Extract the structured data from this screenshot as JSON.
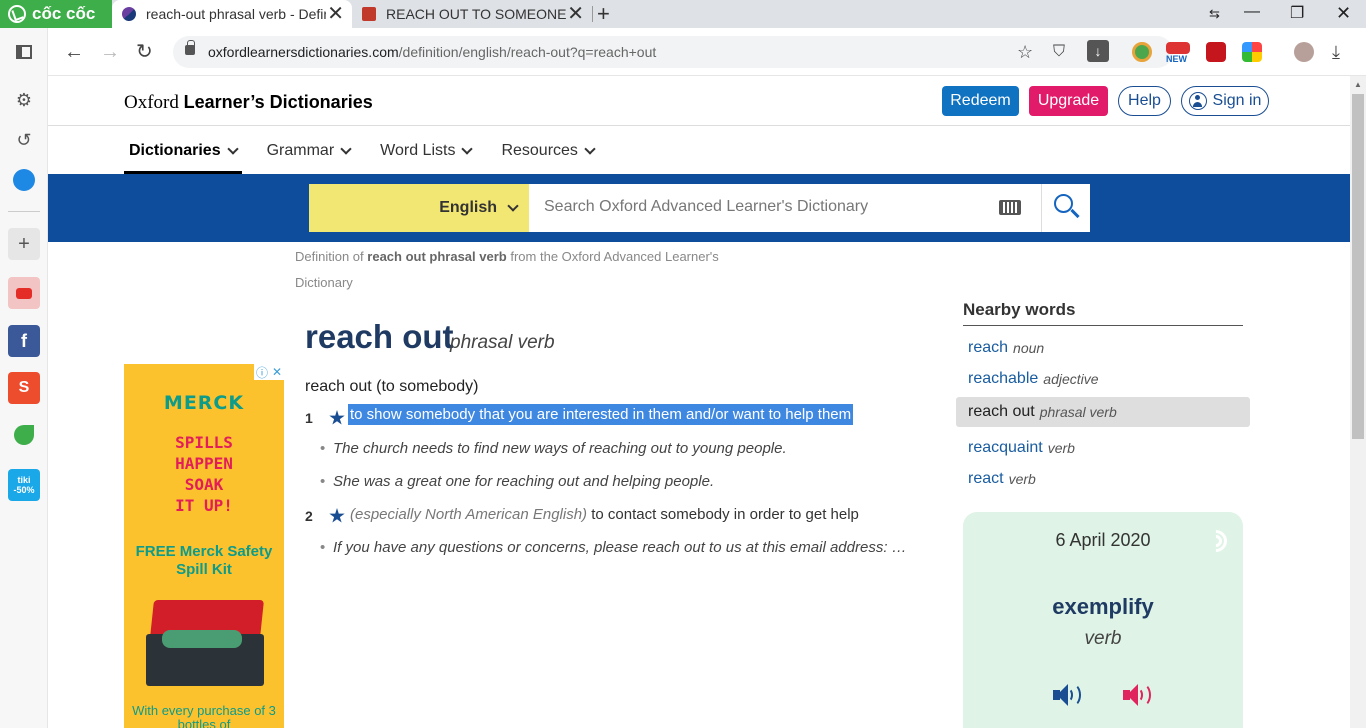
{
  "browser": {
    "brand_label": "cốc cốc",
    "tabs": [
      {
        "title": "reach-out phrasal verb - Defin",
        "active": true
      },
      {
        "title": "REACH OUT TO SOMEONE | E",
        "active": false
      }
    ],
    "address_host": "oxfordlearnersdictionaries.com",
    "address_path": "/definition/english/reach-out?q=reach+out",
    "new_badge": "NEW"
  },
  "sidebar": {
    "apps": [
      "settings-icon",
      "history-icon",
      "messenger-icon",
      "add-icon",
      "youtube-icon",
      "facebook-icon",
      "shopee-icon",
      "cococ-leaf-icon",
      "tiki-icon"
    ],
    "tiki_label": "tiki -50%"
  },
  "header": {
    "site_title_part1": "Oxford",
    "site_title_part2": "Learner’s Dictionaries",
    "redeem": "Redeem",
    "upgrade": "Upgrade",
    "help": "Help",
    "signin": "Sign in"
  },
  "nav": {
    "items": [
      "Dictionaries",
      "Grammar",
      "Word Lists",
      "Resources"
    ]
  },
  "search": {
    "language": "English",
    "placeholder": "Search Oxford Advanced Learner's Dictionary"
  },
  "entry": {
    "definition_of_prefix": "Definition of",
    "definition_of_bold": "reach out phrasal verb",
    "definition_of_suffix": "from the Oxford Advanced Learner's Dictionary",
    "headword": "reach out",
    "pos": "phrasal verb",
    "sense_head": "reach out (to somebody)",
    "senses": [
      {
        "num": "1",
        "definition": "to show somebody that you are interested in them and/or want to help them",
        "examples": [
          "The church needs to find new ways of reaching out to young people.",
          "She was a great one for reaching out and helping people."
        ]
      },
      {
        "num": "2",
        "label": "(especially North American English)",
        "definition": "to contact somebody in order to get help",
        "examples": [
          "If you have any questions or concerns, please reach out to us at this email address: …"
        ]
      }
    ]
  },
  "ad": {
    "logo": "MERCK",
    "headline": [
      "SPILLS",
      "HAPPEN",
      "SOAK",
      "IT UP!"
    ],
    "offer": "FREE Merck Safety Spill Kit",
    "footer": "With every purchase of 3 bottles of"
  },
  "nearby": {
    "title": "Nearby words",
    "items": [
      {
        "word": "reach",
        "pos": "noun"
      },
      {
        "word": "reachable",
        "pos": "adjective"
      },
      {
        "word": "reach out",
        "pos": "phrasal verb",
        "current": true
      },
      {
        "word": "reacquaint",
        "pos": "verb"
      },
      {
        "word": "react",
        "pos": "verb"
      }
    ]
  },
  "word_of_the_day": {
    "date": "6 April 2020",
    "word": "exemplify",
    "pos": "verb"
  },
  "colors": {
    "oxford_blue": "#0d4d9c",
    "redeem": "#0f73c2",
    "upgrade": "#e11a6a",
    "highlight": "#3f88e2",
    "language_bg": "#f3e774",
    "wotd_bg": "#dff4e6",
    "us_speaker": "#e0245e",
    "uk_speaker": "#1a4e93"
  }
}
